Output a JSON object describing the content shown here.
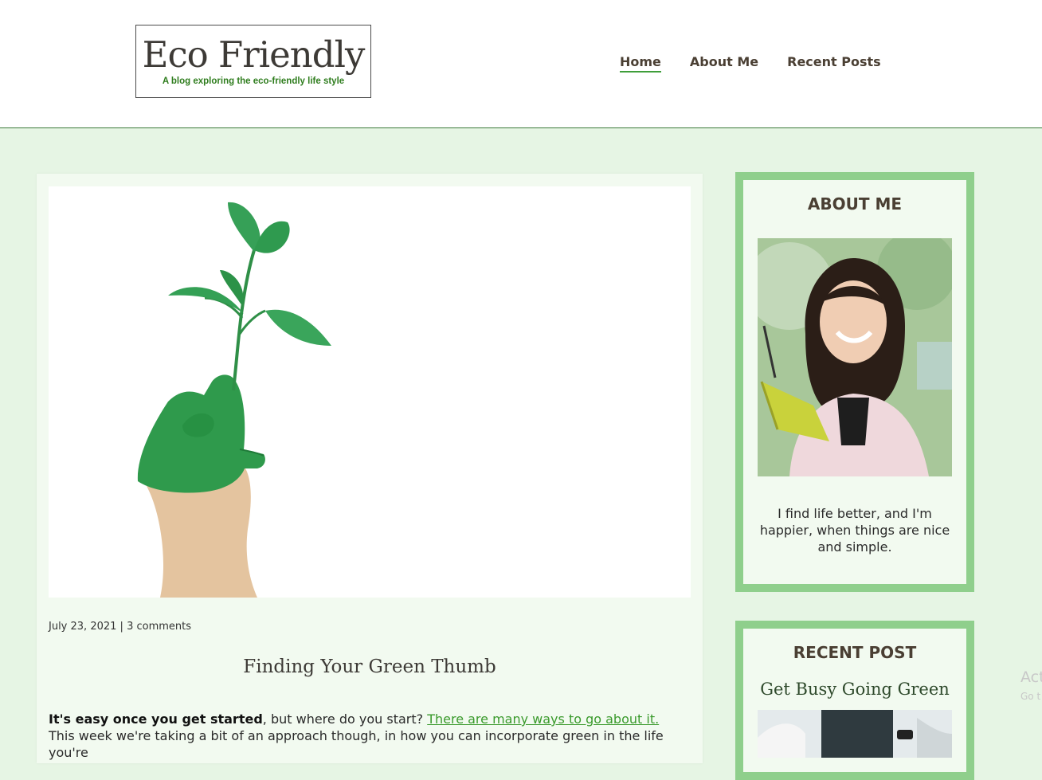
{
  "site": {
    "title": "Eco Friendly",
    "tagline": "A blog exploring the eco-friendly life style"
  },
  "nav": {
    "items": [
      {
        "label": "Home",
        "active": true
      },
      {
        "label": "About Me",
        "active": false
      },
      {
        "label": "Recent Posts",
        "active": false
      }
    ]
  },
  "post": {
    "date": "July 23, 2021",
    "separator": " | ",
    "comments": "3 comments",
    "title": "Finding Your Green Thumb",
    "body_strong": "It's easy once you get started",
    "body_text1": ", but where do you start? ",
    "body_link": "There are many ways to go about it.",
    "body_text2": " This week we're taking a bit of an approach though, in how you can incorporate green in the life you're"
  },
  "about": {
    "heading": "ABOUT ME",
    "text": "I find life better, and I'm happier, when things are nice and simple."
  },
  "recent": {
    "heading": "RECENT POST",
    "post_title": "Get Busy Going Green"
  },
  "watermark": {
    "line1": "Act",
    "line2": "Go t"
  },
  "colors": {
    "accent": "#3f9e3a",
    "widget_border": "#8fcf8c",
    "page_bg": "#e6f5e4",
    "card_bg": "#f2faf0"
  }
}
